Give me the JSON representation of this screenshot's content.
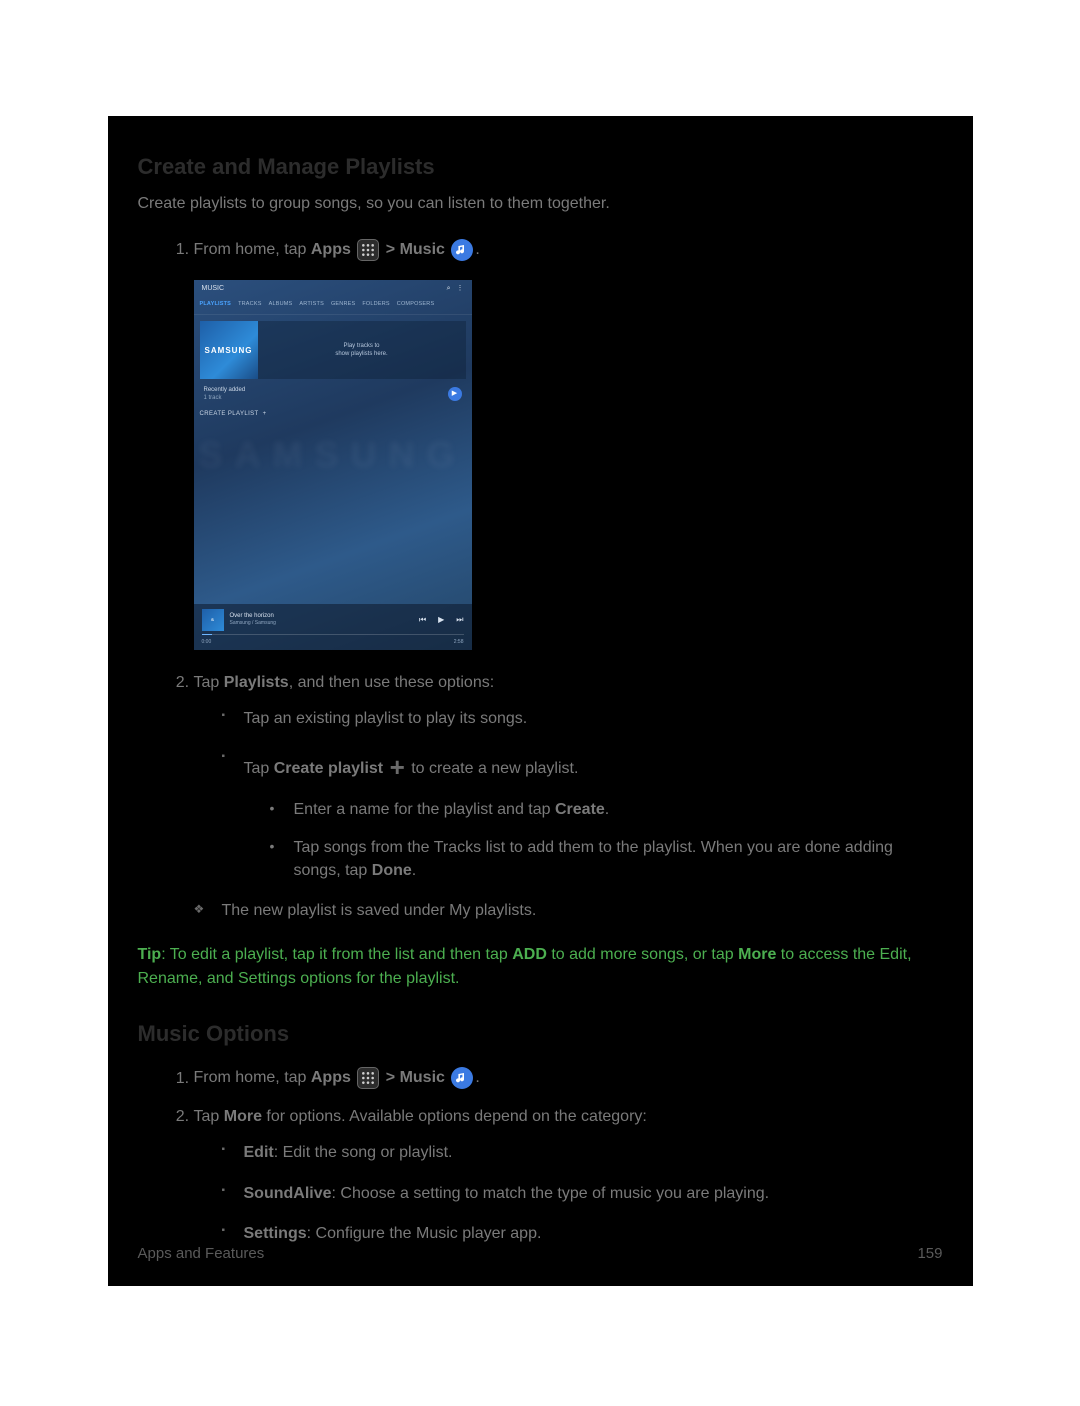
{
  "headings": {
    "playlists": "Create and Manage Playlists",
    "options": "Music Options"
  },
  "intro": "Create playlists to group songs, so you can listen to them together.",
  "step1": {
    "pre": "From home, tap ",
    "apps": "Apps",
    "mid": " > ",
    "music": "Music",
    "post": "."
  },
  "step2": {
    "pre": "Tap ",
    "bold": "Playlists",
    "post": ", and then use these options:"
  },
  "bullets": {
    "b1": "Tap an existing playlist to play its songs.",
    "b2_pre": "Tap ",
    "b2_bold": "Create playlist",
    "b2_post": " to create a new playlist.",
    "b2a_pre": "Enter a name for the playlist and tap ",
    "b2a_bold": "Create",
    "b2a_post": ".",
    "b2b_pre": "Tap songs from the Tracks list to add them to the playlist. When you are done adding songs, tap ",
    "b2b_bold": "Done",
    "b2b_post": "."
  },
  "diamond": "The new playlist is saved under My playlists.",
  "tip": {
    "label": "Tip",
    "pre": ": To edit a playlist, tap it from the list and then tap ",
    "b1": "ADD",
    "mid": " to add more songs, or tap ",
    "b2": "More",
    "post": " to access the Edit, Rename, and Settings options for the playlist."
  },
  "opt_step2": {
    "pre": "Tap ",
    "bold": "More",
    "post": " for options. Available options depend on the category:"
  },
  "opt_bullets": {
    "edit_b": "Edit",
    "edit_t": ": Edit the song or playlist.",
    "sa_b": "SoundAlive",
    "sa_t": ": Choose a setting to match the type of music you are playing.",
    "set_b": "Settings",
    "set_t": ": Configure the Music player app."
  },
  "footer": {
    "section": "Apps and Features",
    "page": "159"
  },
  "screenshot": {
    "title": "MUSIC",
    "tabs": [
      "PLAYLISTS",
      "TRACKS",
      "ALBUMS",
      "ARTISTS",
      "GENRES",
      "FOLDERS",
      "COMPOSERS"
    ],
    "card_msg1": "Play tracks to",
    "card_msg2": "show playlists here.",
    "recent_label": "Recently added",
    "recent_sub": "1 track",
    "create_label": "CREATE PLAYLIST",
    "bgword": "SAMSUNG",
    "now_title": "Over the horizon",
    "now_sub": "Samsung / Samsung",
    "t_cur": "0:00",
    "t_tot": "2:58",
    "cover_brand": "SAMSUNG"
  }
}
